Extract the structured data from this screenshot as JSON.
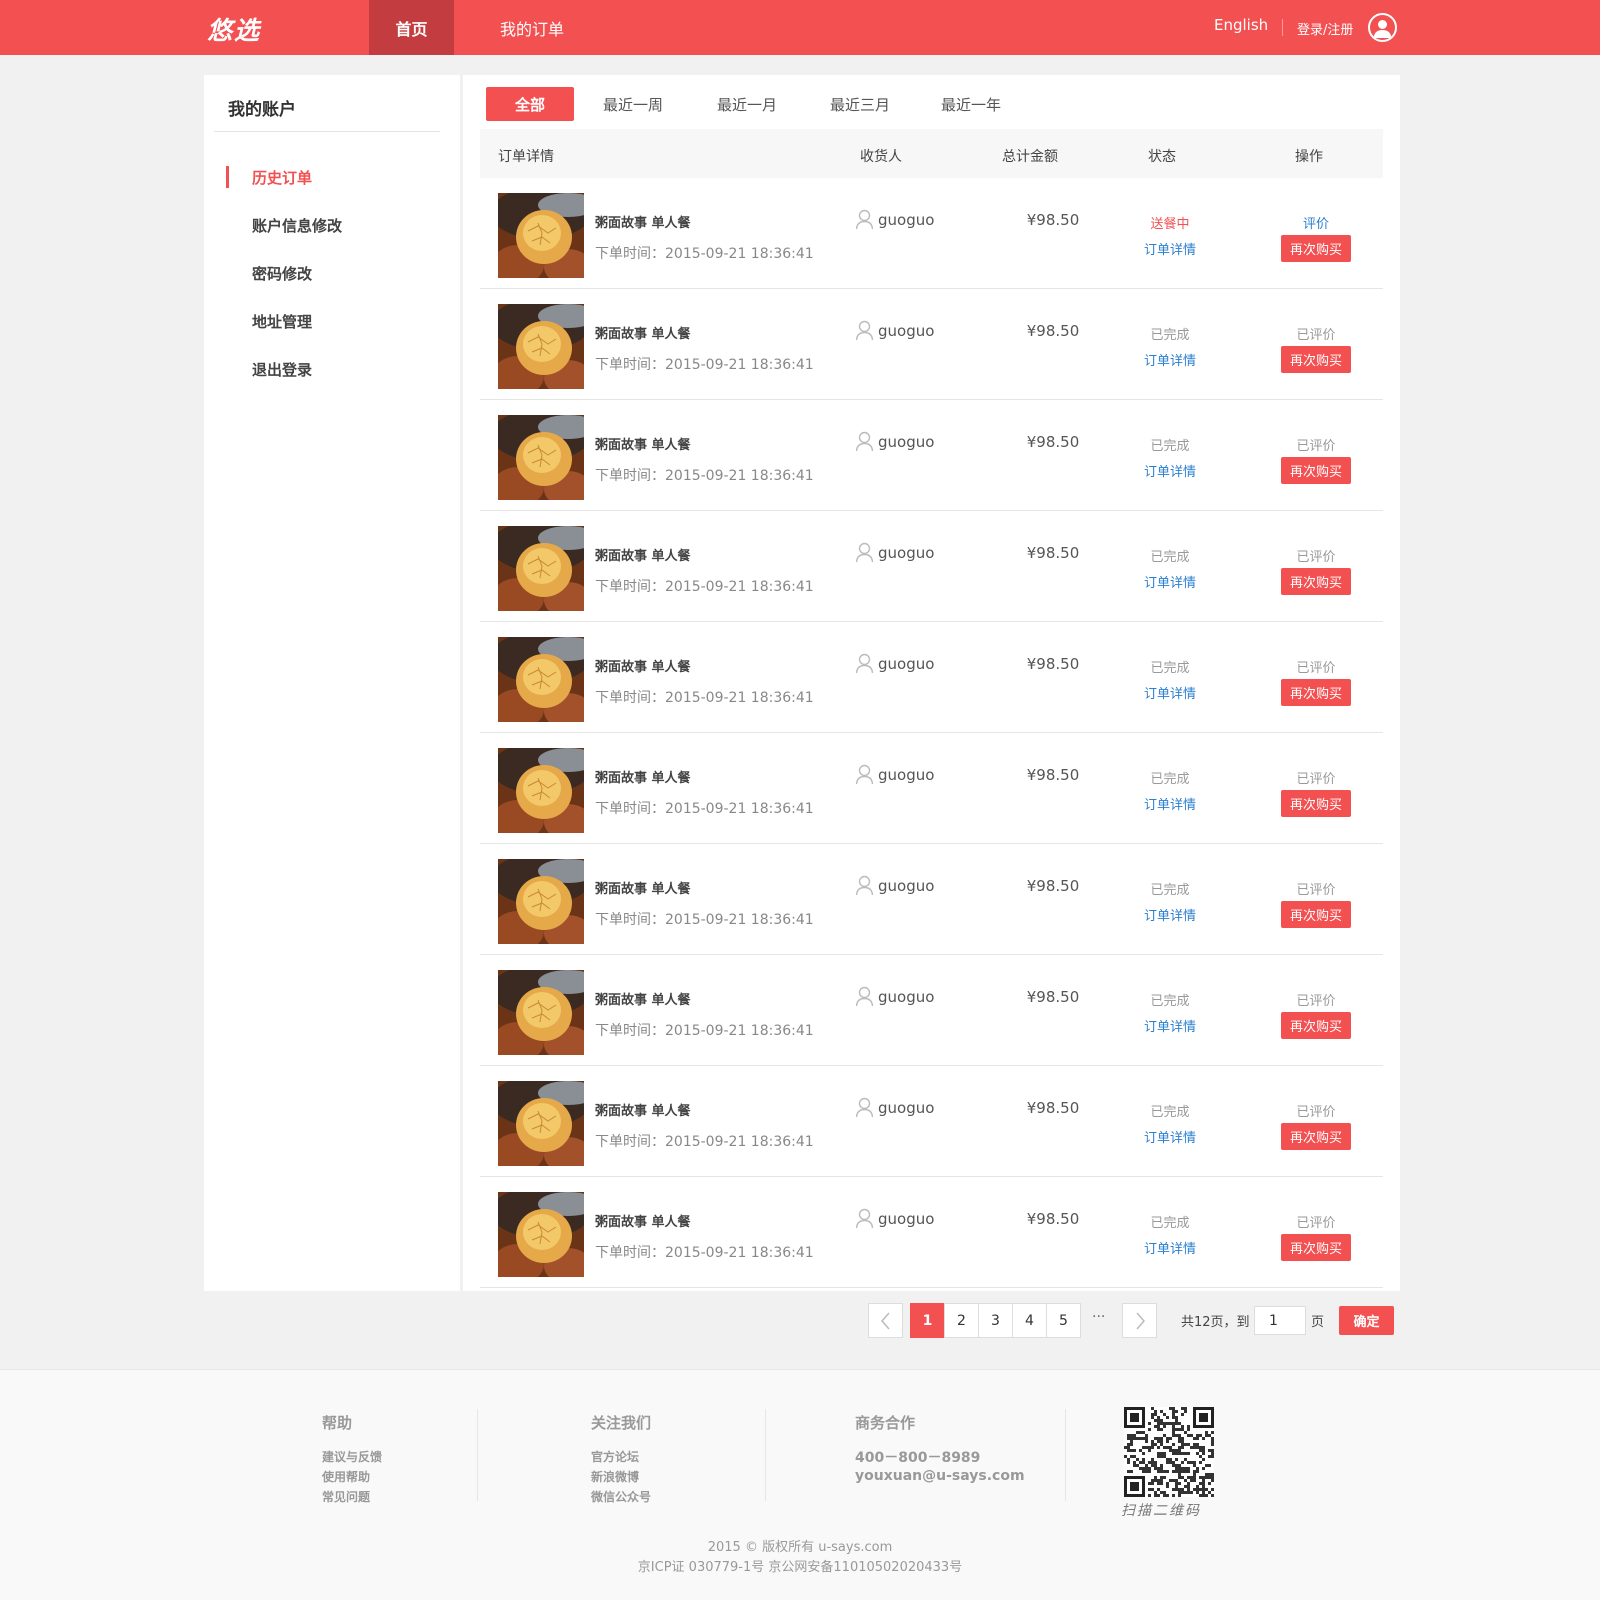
{
  "header": {
    "logo": "悠选",
    "nav_home": "首页",
    "nav_orders": "我的订单",
    "language": "English",
    "login": "登录/注册",
    "brand_color": "#f35052"
  },
  "sidebar": {
    "title": "我的账户",
    "items": [
      {
        "label": "历史订单",
        "active": true
      },
      {
        "label": "账户信息修改"
      },
      {
        "label": "密码修改"
      },
      {
        "label": "地址管理"
      },
      {
        "label": "退出登录"
      }
    ]
  },
  "tabs": [
    "全部",
    "最近一周",
    "最近一月",
    "最近三月",
    "最近一年"
  ],
  "table": {
    "headers": [
      "订单详情",
      "收货人",
      "总计金额",
      "状态",
      "操作"
    ],
    "rows": [
      {
        "name": "粥面故事 单人餐",
        "time": "下单时间：2015-09-21 18:36:41",
        "recipient": "guoguo",
        "amount": "¥98.50",
        "status": "送餐中",
        "detail": "订单详情",
        "review": "评价",
        "rebuy": "再次购买"
      },
      {
        "name": "粥面故事 单人餐",
        "time": "下单时间：2015-09-21 18:36:41",
        "recipient": "guoguo",
        "amount": "¥98.50",
        "status": "已完成",
        "detail": "订单详情",
        "review": "已评价",
        "rebuy": "再次购买"
      },
      {
        "name": "粥面故事 单人餐",
        "time": "下单时间：2015-09-21 18:36:41",
        "recipient": "guoguo",
        "amount": "¥98.50",
        "status": "已完成",
        "detail": "订单详情",
        "review": "已评价",
        "rebuy": "再次购买"
      },
      {
        "name": "粥面故事 单人餐",
        "time": "下单时间：2015-09-21 18:36:41",
        "recipient": "guoguo",
        "amount": "¥98.50",
        "status": "已完成",
        "detail": "订单详情",
        "review": "已评价",
        "rebuy": "再次购买"
      },
      {
        "name": "粥面故事 单人餐",
        "time": "下单时间：2015-09-21 18:36:41",
        "recipient": "guoguo",
        "amount": "¥98.50",
        "status": "已完成",
        "detail": "订单详情",
        "review": "已评价",
        "rebuy": "再次购买"
      },
      {
        "name": "粥面故事 单人餐",
        "time": "下单时间：2015-09-21 18:36:41",
        "recipient": "guoguo",
        "amount": "¥98.50",
        "status": "已完成",
        "detail": "订单详情",
        "review": "已评价",
        "rebuy": "再次购买"
      },
      {
        "name": "粥面故事 单人餐",
        "time": "下单时间：2015-09-21 18:36:41",
        "recipient": "guoguo",
        "amount": "¥98.50",
        "status": "已完成",
        "detail": "订单详情",
        "review": "已评价",
        "rebuy": "再次购买"
      },
      {
        "name": "粥面故事 单人餐",
        "time": "下单时间：2015-09-21 18:36:41",
        "recipient": "guoguo",
        "amount": "¥98.50",
        "status": "已完成",
        "detail": "订单详情",
        "review": "已评价",
        "rebuy": "再次购买"
      },
      {
        "name": "粥面故事 单人餐",
        "time": "下单时间：2015-09-21 18:36:41",
        "recipient": "guoguo",
        "amount": "¥98.50",
        "status": "已完成",
        "detail": "订单详情",
        "review": "已评价",
        "rebuy": "再次购买"
      },
      {
        "name": "粥面故事 单人餐",
        "time": "下单时间：2015-09-21 18:36:41",
        "recipient": "guoguo",
        "amount": "¥98.50",
        "status": "已完成",
        "detail": "订单详情",
        "review": "已评价",
        "rebuy": "再次购买"
      }
    ]
  },
  "pagination": {
    "pages": [
      "1",
      "2",
      "3",
      "4",
      "5"
    ],
    "current": "1",
    "ellipsis": "···",
    "total": "共12页，到",
    "input_value": "1",
    "unit": "页",
    "confirm": "确定"
  },
  "footer": {
    "help": {
      "title": "帮助",
      "links": [
        "建议与反馈",
        "使用帮助",
        "常见问题"
      ]
    },
    "follow": {
      "title": "关注我们",
      "links": [
        "官方论坛",
        "新浪微博",
        "微信公众号"
      ]
    },
    "business": {
      "title": "商务合作",
      "phone": "400－800－8989",
      "email": "youxuan@u-says.com"
    },
    "qr_caption": "扫描二维码",
    "copyright": "2015 © 版权所有 u-says.com",
    "icp": "京ICP证 030779-1号 京公网安备11010502020433号"
  }
}
